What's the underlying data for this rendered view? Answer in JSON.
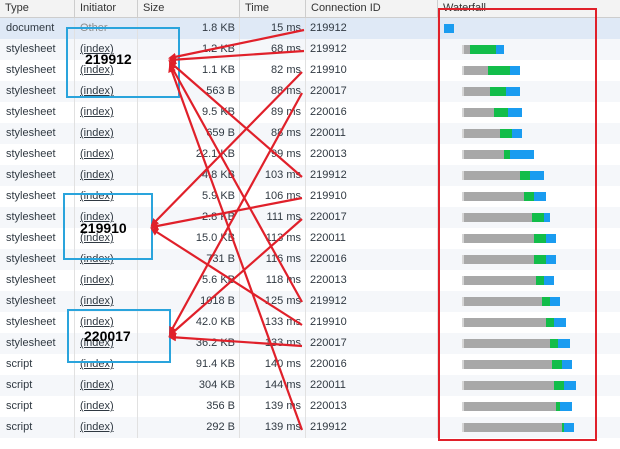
{
  "header": {
    "type": "Type",
    "initiator": "Initiator",
    "size": "Size",
    "time": "Time",
    "connection_id": "Connection ID",
    "waterfall": "Waterfall"
  },
  "rows": [
    {
      "type": "document",
      "initiator": "Other",
      "size": "1.8 KB",
      "time": "15 ms",
      "conn": "219912"
    },
    {
      "type": "stylesheet",
      "initiator": "(index)",
      "size": "1.2 KB",
      "time": "68 ms",
      "conn": "219912"
    },
    {
      "type": "stylesheet",
      "initiator": "(index)",
      "size": "1.1 KB",
      "time": "82 ms",
      "conn": "219910"
    },
    {
      "type": "stylesheet",
      "initiator": "(index)",
      "size": "563 B",
      "time": "88 ms",
      "conn": "220017"
    },
    {
      "type": "stylesheet",
      "initiator": "(index)",
      "size": "9.5 KB",
      "time": "89 ms",
      "conn": "220016"
    },
    {
      "type": "stylesheet",
      "initiator": "(index)",
      "size": "659 B",
      "time": "88 ms",
      "conn": "220011"
    },
    {
      "type": "stylesheet",
      "initiator": "(index)",
      "size": "22.1 KB",
      "time": "99 ms",
      "conn": "220013"
    },
    {
      "type": "stylesheet",
      "initiator": "(index)",
      "size": "4.8 KB",
      "time": "103 ms",
      "conn": "219912"
    },
    {
      "type": "stylesheet",
      "initiator": "(index)",
      "size": "5.9 KB",
      "time": "106 ms",
      "conn": "219910"
    },
    {
      "type": "stylesheet",
      "initiator": "(index)",
      "size": "2.8 KB",
      "time": "111 ms",
      "conn": "220017"
    },
    {
      "type": "stylesheet",
      "initiator": "(index)",
      "size": "15.0 KB",
      "time": "113 ms",
      "conn": "220011"
    },
    {
      "type": "stylesheet",
      "initiator": "(index)",
      "size": "731 B",
      "time": "116 ms",
      "conn": "220016"
    },
    {
      "type": "stylesheet",
      "initiator": "(index)",
      "size": "5.6 KB",
      "time": "118 ms",
      "conn": "220013"
    },
    {
      "type": "stylesheet",
      "initiator": "(index)",
      "size": "1018 B",
      "time": "125 ms",
      "conn": "219912"
    },
    {
      "type": "stylesheet",
      "initiator": "(index)",
      "size": "42.0 KB",
      "time": "133 ms",
      "conn": "219910"
    },
    {
      "type": "stylesheet",
      "initiator": "(index)",
      "size": "36.2 KB",
      "time": "133 ms",
      "conn": "220017"
    },
    {
      "type": "script",
      "initiator": "(index)",
      "size": "91.4 KB",
      "time": "140 ms",
      "conn": "220016"
    },
    {
      "type": "script",
      "initiator": "(index)",
      "size": "304 KB",
      "time": "144 ms",
      "conn": "220011"
    },
    {
      "type": "script",
      "initiator": "(index)",
      "size": "356 B",
      "time": "139 ms",
      "conn": "220013"
    },
    {
      "type": "script",
      "initiator": "(index)",
      "size": "292 B",
      "time": "139 ms",
      "conn": "219912"
    }
  ],
  "annotations": {
    "labels": [
      "219912",
      "219910",
      "220017"
    ],
    "box_color": "#2aa4dc",
    "arrow_color": "#e0202a",
    "waterfall_box_color": "#e0202a"
  },
  "colors": {
    "waiting": "#a8a8a8",
    "ttfb": "#12bd4a",
    "download": "#1a9cf0"
  }
}
